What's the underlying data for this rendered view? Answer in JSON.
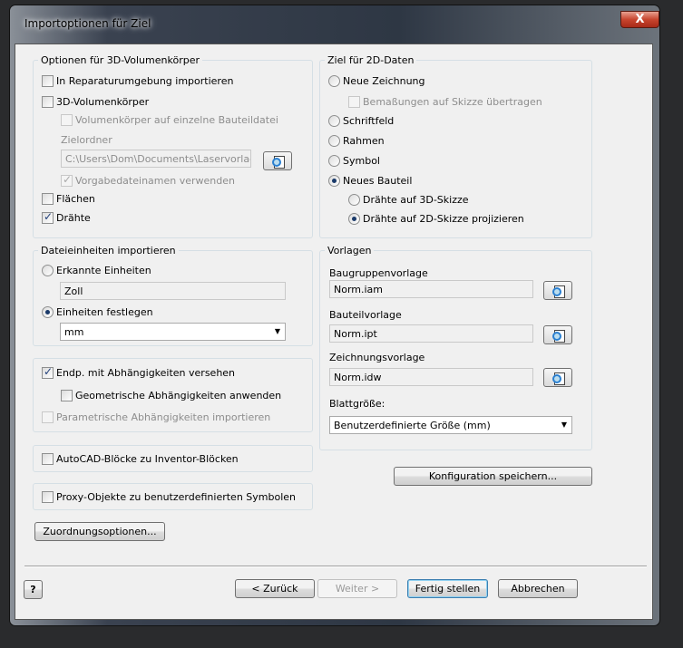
{
  "window": {
    "title": "Importoptionen für Ziel",
    "close": "X"
  },
  "solids": {
    "title": "Optionen für 3D-Volumenkörper",
    "repair": "In Reparaturumgebung importieren",
    "solids3d": "3D-Volumenkörper",
    "single_part": "Volumenkörper auf einzelne Bauteildatei",
    "target_folder_label": "Zielordner",
    "target_folder": "C:\\Users\\Dom\\Documents\\Laservorlagen",
    "default_names": "Vorgabedateinamen verwenden",
    "surfaces": "Flächen",
    "wires": "Drähte"
  },
  "units": {
    "title": "Dateieinheiten importieren",
    "detected": "Erkannte Einheiten",
    "detected_value": "Zoll",
    "specify": "Einheiten festlegen",
    "unit_value": "mm"
  },
  "constraints": {
    "endpoints": "Endp. mit Abhängigkeiten versehen",
    "geometric": "Geometrische Abhängigkeiten anwenden",
    "parametric": "Parametrische Abhängigkeiten importieren"
  },
  "autocad_blocks": "AutoCAD-Blöcke zu Inventor-Blöcken",
  "proxy": "Proxy-Objekte zu benutzerdefinierten Symbolen",
  "mapping_button": "Zuordnungsoptionen...",
  "target2d": {
    "title": "Ziel für 2D-Daten",
    "new_drawing": "Neue Zeichnung",
    "dimensions": "Bemaßungen auf Skizze übertragen",
    "title_block": "Schriftfeld",
    "border": "Rahmen",
    "symbol": "Symbol",
    "new_part": "Neues Bauteil",
    "wires_3d": "Drähte auf 3D-Skizze",
    "wires_2d": "Drähte auf 2D-Skizze projizieren"
  },
  "templates": {
    "title": "Vorlagen",
    "assembly_label": "Baugruppenvorlage",
    "assembly": "Norm.iam",
    "part_label": "Bauteilvorlage",
    "part": "Norm.ipt",
    "drawing_label": "Zeichnungsvorlage",
    "drawing": "Norm.idw",
    "sheet_label": "Blattgröße:",
    "sheet": "Benutzerdefinierte Größe (mm)"
  },
  "save_config": "Konfiguration speichern...",
  "footer": {
    "help": "?",
    "back": "< Zurück",
    "next": "Weiter >",
    "finish": "Fertig stellen",
    "cancel": "Abbrechen"
  }
}
